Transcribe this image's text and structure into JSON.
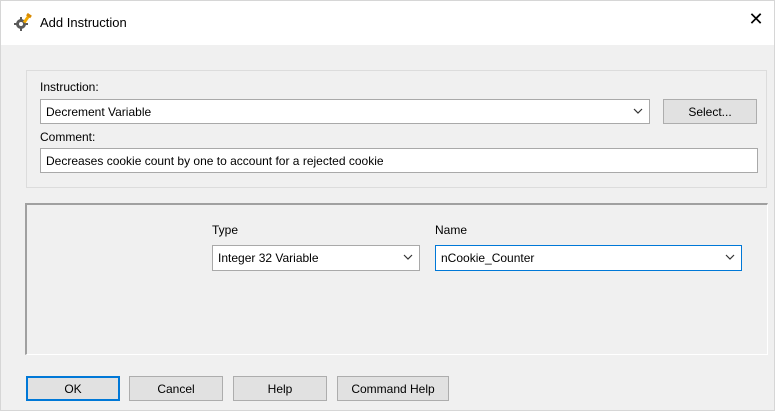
{
  "window": {
    "title": "Add Instruction",
    "icon": "gear-wrench-icon",
    "close_glyph": "✕"
  },
  "instruction": {
    "label": "Instruction:",
    "value": "Decrement Variable",
    "select_button": "Select..."
  },
  "comment": {
    "label": "Comment:",
    "value": "Decreases cookie count by one to account for a rejected cookie"
  },
  "params": {
    "type_label": "Type",
    "type_value": "Integer 32 Variable",
    "name_label": "Name",
    "name_value": "nCookie_Counter"
  },
  "buttons": {
    "ok": "OK",
    "cancel": "Cancel",
    "help": "Help",
    "command_help": "Command Help"
  },
  "colors": {
    "accent": "#0078d7",
    "window_bg": "#f0f0f0"
  }
}
